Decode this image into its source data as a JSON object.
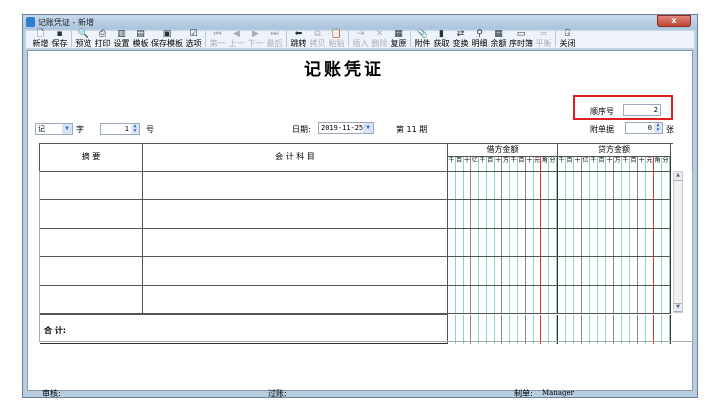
{
  "window": {
    "title": "记账凭证 - 新增",
    "close": "x"
  },
  "toolbar": [
    {
      "icon": "new-icon",
      "glyph": "🗋",
      "label": "新增",
      "enabled": true
    },
    {
      "icon": "save-icon",
      "glyph": "▪",
      "label": "保存",
      "enabled": true
    },
    {
      "sep": true
    },
    {
      "icon": "preview-icon",
      "glyph": "🔍",
      "label": "预览",
      "enabled": true
    },
    {
      "icon": "print-icon",
      "glyph": "⎙",
      "label": "打印",
      "enabled": true
    },
    {
      "icon": "settings-icon",
      "glyph": "▥",
      "label": "设置",
      "enabled": true
    },
    {
      "icon": "template-icon",
      "glyph": "▤",
      "label": "模板",
      "enabled": true
    },
    {
      "icon": "save-template-icon",
      "glyph": "▣",
      "label": "保存模板",
      "enabled": true
    },
    {
      "icon": "options-icon",
      "glyph": "☑",
      "label": "选项",
      "enabled": true
    },
    {
      "sep": true
    },
    {
      "icon": "first-icon",
      "glyph": "⏮",
      "label": "第一",
      "enabled": false
    },
    {
      "icon": "prev-icon",
      "glyph": "◀",
      "label": "上一",
      "enabled": false
    },
    {
      "icon": "next-icon",
      "glyph": "▶",
      "label": "下一",
      "enabled": false
    },
    {
      "icon": "last-icon",
      "glyph": "⏭",
      "label": "最后",
      "enabled": false
    },
    {
      "sep": true
    },
    {
      "icon": "jump-icon",
      "glyph": "⬅",
      "label": "跳转",
      "enabled": true
    },
    {
      "icon": "copy-icon",
      "glyph": "⧉",
      "label": "拷贝",
      "enabled": false
    },
    {
      "icon": "paste-icon",
      "glyph": "📋",
      "label": "粘贴",
      "enabled": false
    },
    {
      "sep": true
    },
    {
      "icon": "insert-icon",
      "glyph": "⇥",
      "label": "插入",
      "enabled": false
    },
    {
      "icon": "delete-icon",
      "glyph": "✕",
      "label": "删除",
      "enabled": false
    },
    {
      "icon": "restore-icon",
      "glyph": "▦",
      "label": "复原",
      "enabled": true
    },
    {
      "sep": true
    },
    {
      "icon": "attachment-icon",
      "glyph": "📎",
      "label": "附件",
      "enabled": true
    },
    {
      "icon": "fetch-icon",
      "glyph": "▮",
      "label": "获取",
      "enabled": true
    },
    {
      "icon": "swap-icon",
      "glyph": "⇄",
      "label": "变换",
      "enabled": true
    },
    {
      "icon": "binoculars-icon",
      "glyph": "⚲",
      "label": "明细",
      "enabled": true
    },
    {
      "icon": "balance-icon",
      "glyph": "▦",
      "label": "余额",
      "enabled": true
    },
    {
      "icon": "journal-icon",
      "glyph": "▭",
      "label": "序时簿",
      "enabled": true
    },
    {
      "icon": "equal-icon",
      "glyph": "=",
      "label": "平衡",
      "enabled": false
    },
    {
      "sep": true
    },
    {
      "icon": "exit-icon",
      "glyph": "⍈",
      "label": "关闭",
      "enabled": true
    }
  ],
  "voucher": {
    "title": "记账凭证",
    "seq_label": "顺序号",
    "seq_value": "2",
    "type_value": "记",
    "type_label": "字",
    "number_value": "1",
    "number_label": "号",
    "date_label": "日期:",
    "date_value": "2019-11-25",
    "period_label": "第 11 期",
    "attach_label": "附单据",
    "attach_value": "0",
    "attach_unit": "张"
  },
  "table": {
    "col_summary": "摘  要",
    "col_account": "会 计 科 目",
    "col_debit": "借方金额",
    "col_credit": "贷方金额",
    "digits": [
      "千",
      "百",
      "十",
      "亿",
      "千",
      "百",
      "十",
      "万",
      "千",
      "百",
      "十",
      "元",
      "角",
      "分"
    ],
    "total_label": "合  计:"
  },
  "footer": {
    "review": "审核:",
    "post": "过账:",
    "maker_label": "制单:",
    "maker": "Manager"
  },
  "colors": {
    "red_box": "#e02020",
    "grid_line": "#8fd3cf",
    "yuan_line": "#e03030"
  }
}
